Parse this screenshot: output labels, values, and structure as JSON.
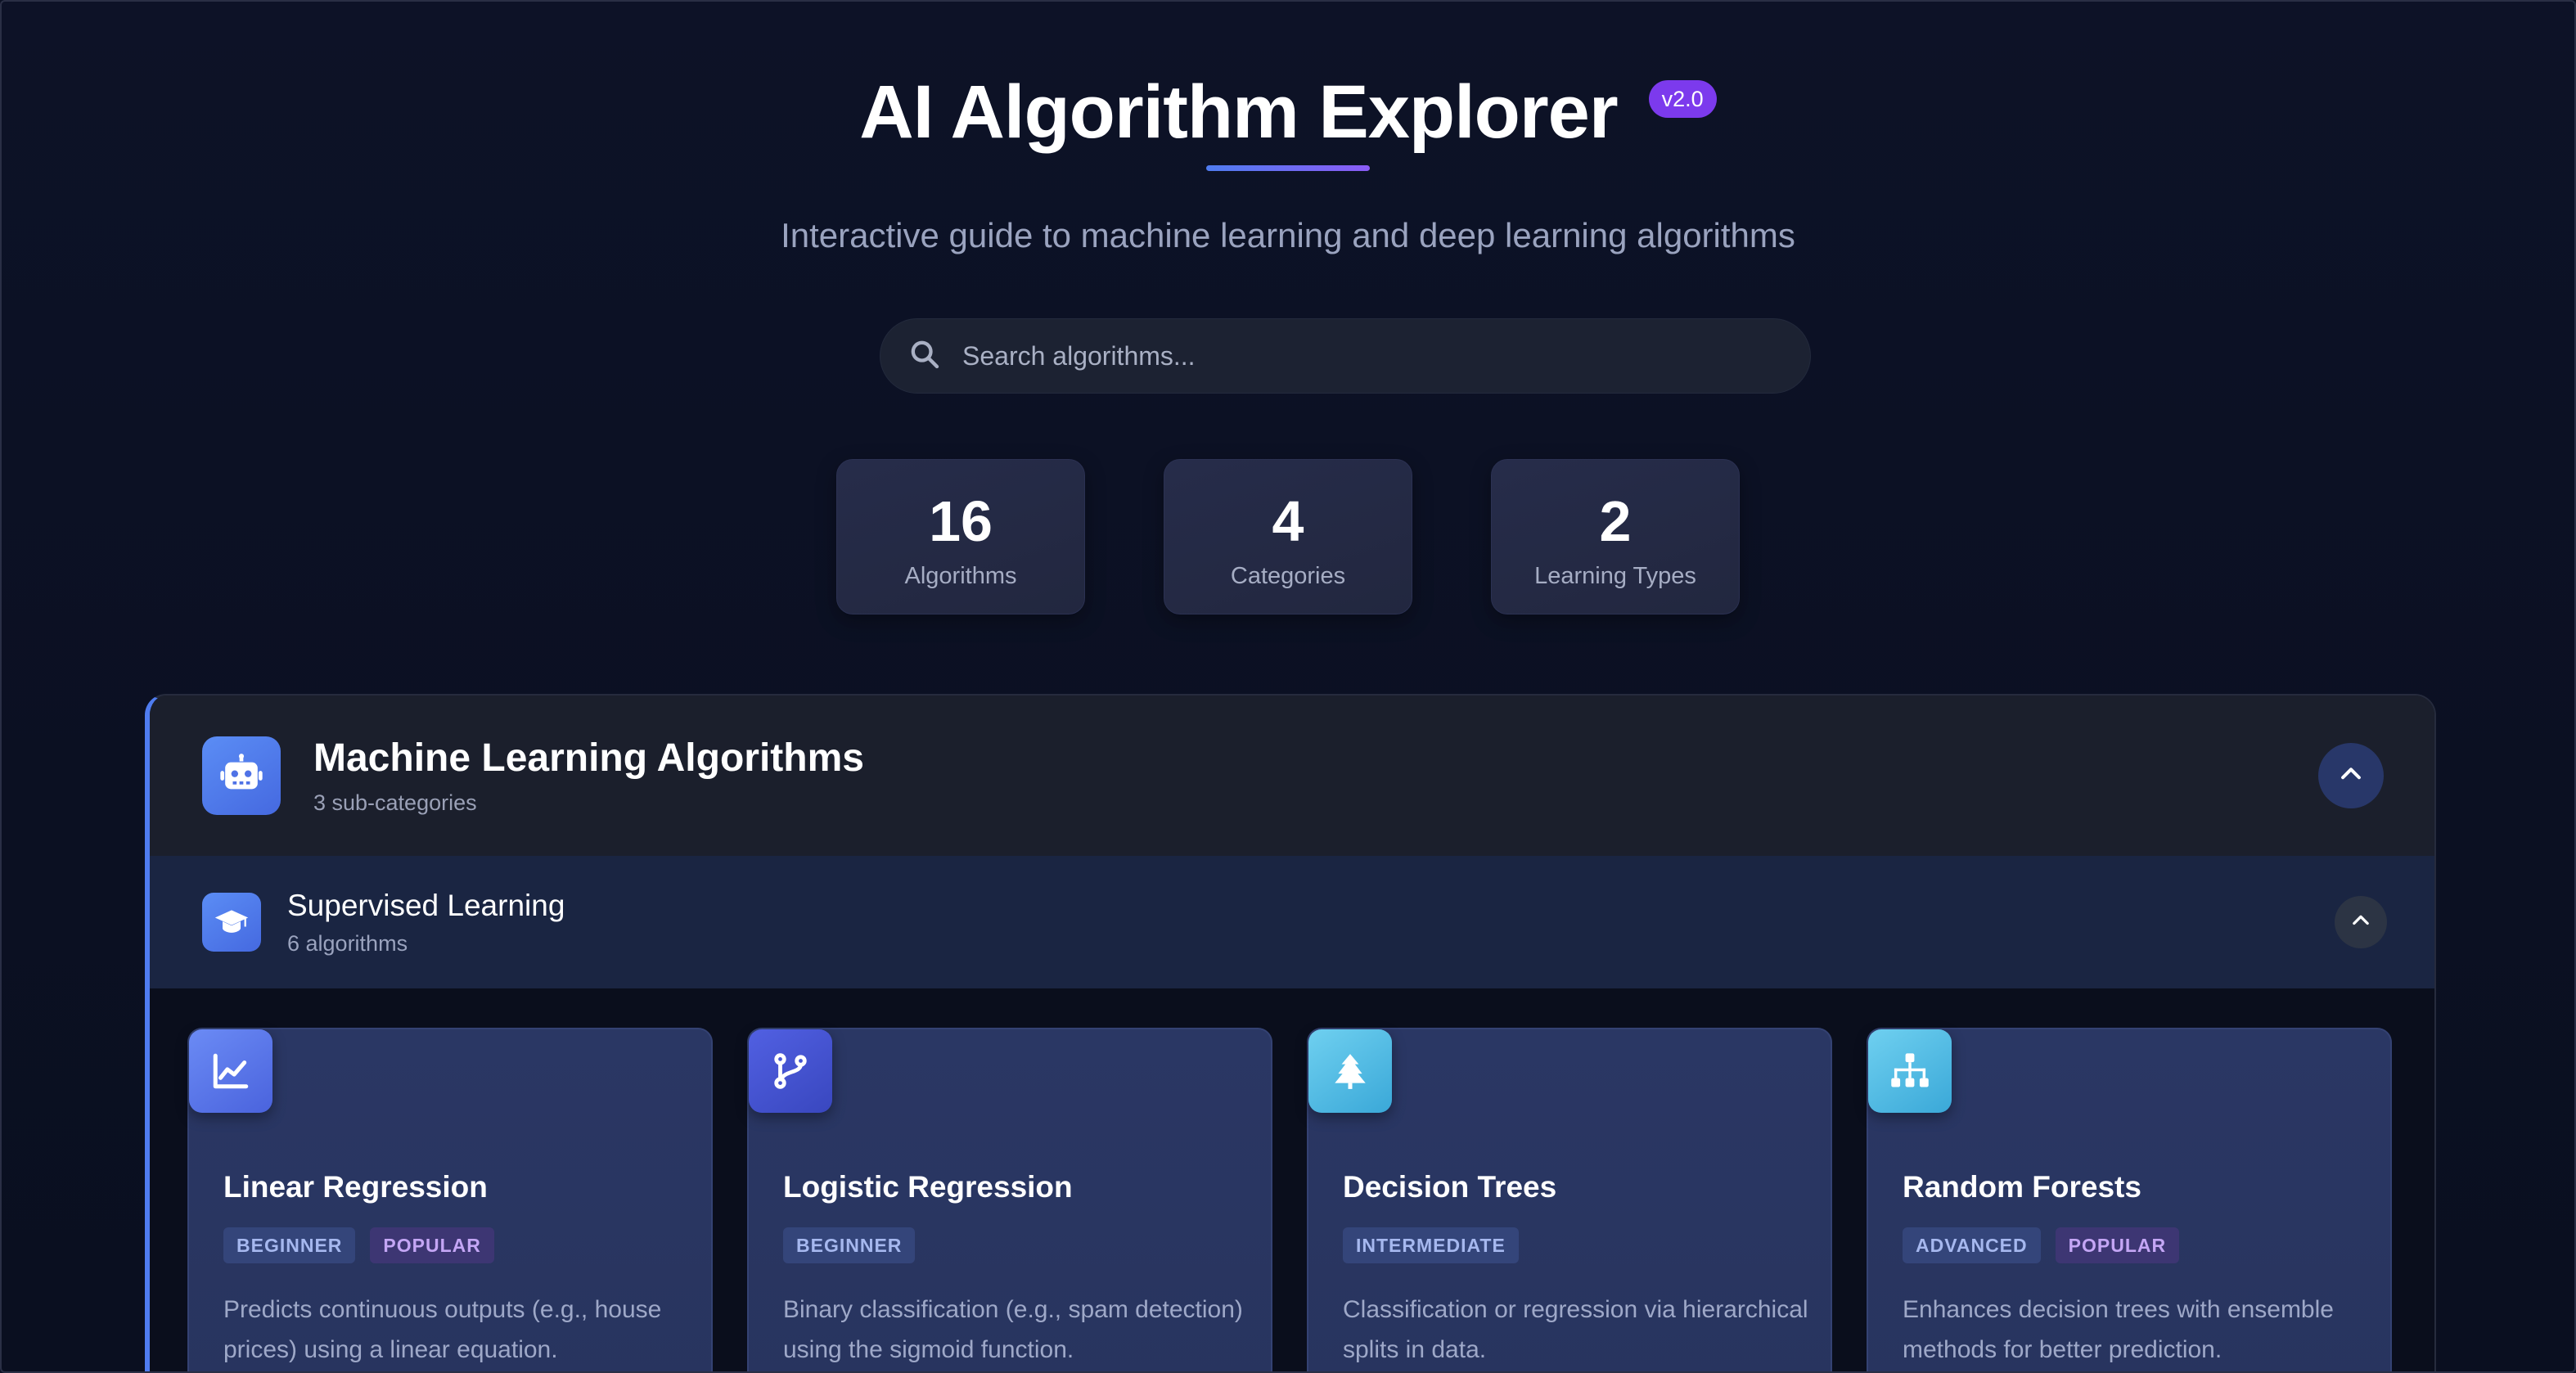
{
  "header": {
    "title": "AI Algorithm Explorer",
    "version": "v2.0",
    "subtitle": "Interactive guide to machine learning and deep learning algorithms"
  },
  "search": {
    "placeholder": "Search algorithms...",
    "icon": "search-icon"
  },
  "stats": [
    {
      "value": "16",
      "label": "Algorithms"
    },
    {
      "value": "4",
      "label": "Categories"
    },
    {
      "value": "2",
      "label": "Learning Types"
    }
  ],
  "category": {
    "title": "Machine Learning Algorithms",
    "subtitle": "3 sub-categories",
    "icon": "robot-icon",
    "toggle_icon": "chevron-up-icon",
    "subcategory": {
      "title": "Supervised Learning",
      "subtitle": "6 algorithms",
      "icon": "graduation-cap-icon",
      "toggle_icon": "chevron-up-icon"
    }
  },
  "cards": [
    {
      "title": "Linear Regression",
      "level": "BEGINNER",
      "popular": "POPULAR",
      "icon": "line-chart-icon",
      "description": "Predicts continuous outputs (e.g., house prices) using a linear equation."
    },
    {
      "title": "Logistic Regression",
      "level": "BEGINNER",
      "popular": "",
      "icon": "branch-icon",
      "description": "Binary classification (e.g., spam detection) using the sigmoid function."
    },
    {
      "title": "Decision Trees",
      "level": "INTERMEDIATE",
      "popular": "",
      "icon": "tree-icon",
      "description": "Classification or regression via hierarchical splits in data."
    },
    {
      "title": "Random Forests",
      "level": "ADVANCED",
      "popular": "POPULAR",
      "icon": "hierarchy-icon",
      "description": "Enhances decision trees with ensemble methods for better prediction."
    }
  ],
  "colors": {
    "background": "#0c1124",
    "accent_blue": "#4f7cf0",
    "accent_purple": "#7c3aed",
    "card_bg": "#2a3764"
  }
}
